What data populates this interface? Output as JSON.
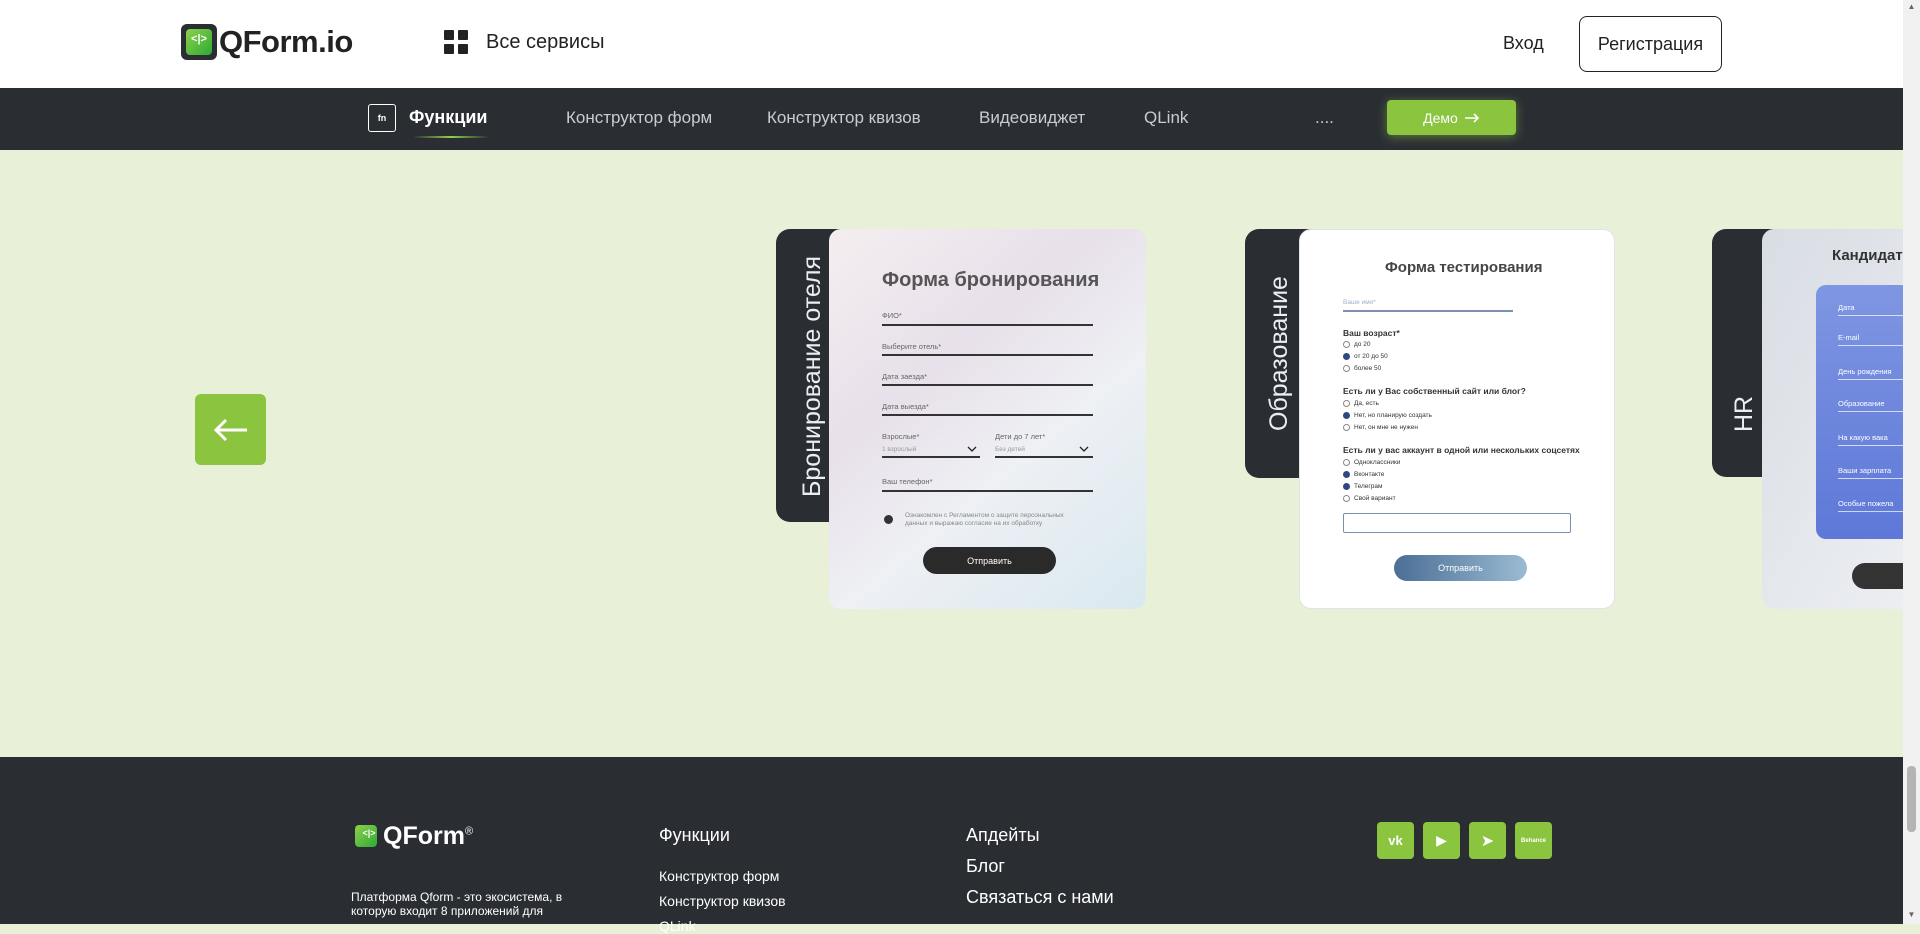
{
  "header": {
    "logo_mark": "<|>",
    "logo_text": "QForm.io",
    "services_label": "Все сервисы",
    "login_label": "Вход",
    "register_label": "Регистрация"
  },
  "nav": {
    "fn_badge": "fn",
    "items": [
      "Функции",
      "Конструктор форм",
      "Конструктор квизов",
      "Видеовиджет",
      "QLink",
      "...."
    ],
    "demo_label": "Демо"
  },
  "carousel": {
    "cards": [
      {
        "tab": "Бронирование отеля",
        "title": "Форма бронирования",
        "fields": [
          "ФИО*",
          "Выберите отель*",
          "Дата заезда*",
          "Дата выезда*"
        ],
        "adults_label": "Взрослые*",
        "adults_value": "1 взрослый",
        "kids_label": "Дети до 7 лет*",
        "kids_value": "Без детей",
        "phone_label": "Ваш телефон*",
        "consent": "Ознакомлен с Регламентом о защите персональных данных и выражаю согласие на их обработку",
        "submit": "Отправить"
      },
      {
        "tab": "Образование",
        "title": "Форма тестирования",
        "name_placeholder": "Ваше имя*",
        "q1": "Ваш возраст*",
        "q1_options": [
          "до 20",
          "от 20 до 50",
          "более 50"
        ],
        "q2": "Есть ли у Вас собственный сайт или блог?",
        "q2_options": [
          "Да, есть",
          "Нет, но планирую создать",
          "Нет, он мне не нужен"
        ],
        "q3": "Есть ли у вас аккаунт в одной или нескольких соцсетях",
        "q3_options": [
          "Одноклассники",
          "Вконтакте",
          "Телеграм",
          "Свой вариант"
        ],
        "submit": "Отправить"
      },
      {
        "tab": "HR",
        "title": "Кандидат",
        "fields": [
          "Дата",
          "E-mail",
          "День рождения",
          "Образование",
          "На какую вака",
          "Ваши зарплата",
          "Особые пожела"
        ]
      }
    ]
  },
  "footer": {
    "logo_text": "QForm",
    "logo_reg": "®",
    "description": "Платформа Qform - это экосистема, в которую входит 8 приложений для",
    "col1_title": "Функции",
    "col1_links": [
      "Конструктор форм",
      "Конструктор квизов",
      "QLink"
    ],
    "col2_links": [
      "Апдейты",
      "Блог",
      "Связаться с нами"
    ],
    "social": [
      "VK",
      "YouTube",
      "Telegram",
      "Behance"
    ],
    "social_glyphs": [
      "vk",
      "▶",
      "➤",
      "Behance"
    ]
  },
  "colors": {
    "accent": "#8bc53f",
    "dark": "#2a2e33",
    "background": "#e8f1d8"
  }
}
